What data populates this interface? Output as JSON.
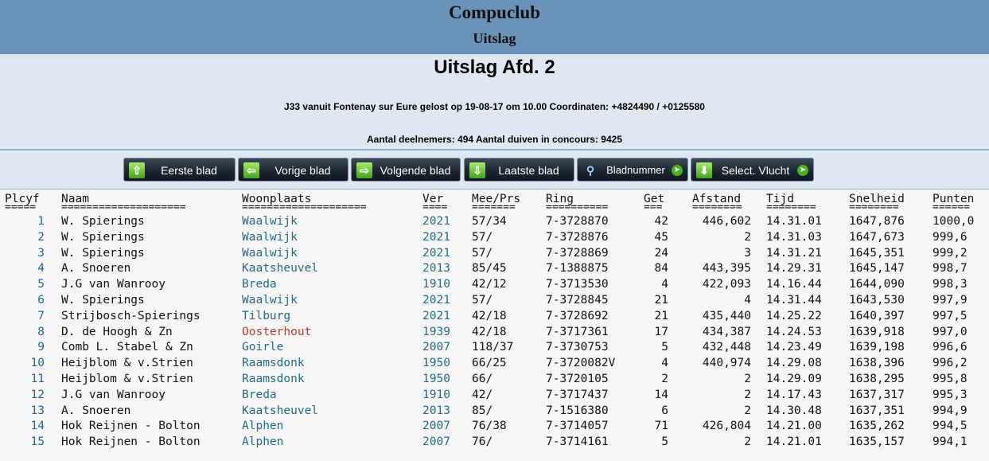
{
  "header": {
    "club": "Compuclub",
    "subtitle": "Uitslag"
  },
  "info": {
    "title": "Uitslag Afd. 2",
    "flight": "J33 vanuit Fontenay sur Eure gelost op 19-08-17 om 10.00 Coordinaten: +4824490 / +0125580",
    "participants": "Aantal deelnemers: 494 Aantal duiven in concours: 9425"
  },
  "nav": {
    "first": "Eerste blad",
    "prev": "Vorige blad",
    "next": "Volgende blad",
    "last": "Laatste blad",
    "page": "Bladnummer",
    "select": "Select. Vlucht"
  },
  "table": {
    "headers": {
      "plcyf": "Plcyf",
      "naam": "Naam",
      "woonplaats": "Woonplaats",
      "ver": "Ver",
      "mee": "Mee/Prs",
      "ring": "Ring",
      "get": "Get",
      "afstand": "Afstand",
      "tijd": "Tijd",
      "snelheid": "Snelheid",
      "punten": "Punten"
    },
    "separators": {
      "plcyf": "=====",
      "naam": "====================",
      "woonplaats": "====================",
      "ver": "====",
      "mee": "=======",
      "ring": "==========",
      "get": "===",
      "afstand": "========",
      "tijd": "========",
      "snelheid": "========",
      "punten": "======"
    },
    "rows": [
      {
        "plcyf": "1",
        "naam": "W. Spierings",
        "woonplaats": "Waalwijk",
        "ver": "2021",
        "mee": "57/34",
        "ring": "7-3728870",
        "get": "42",
        "afstand": "446,602",
        "tijd": "14.31.01",
        "snelheid": "1647,876",
        "punten": "1000,0"
      },
      {
        "plcyf": "2",
        "naam": "W. Spierings",
        "woonplaats": "Waalwijk",
        "ver": "2021",
        "mee": "57/",
        "ring": "7-3728876",
        "get": "45",
        "afstand": "2",
        "tijd": "14.31.03",
        "snelheid": "1647,673",
        "punten": "999,6"
      },
      {
        "plcyf": "3",
        "naam": "W. Spierings",
        "woonplaats": "Waalwijk",
        "ver": "2021",
        "mee": "57/",
        "ring": "7-3728869",
        "get": "24",
        "afstand": "3",
        "tijd": "14.31.21",
        "snelheid": "1645,351",
        "punten": "999,2"
      },
      {
        "plcyf": "4",
        "naam": "A. Snoeren",
        "woonplaats": "Kaatsheuvel",
        "ver": "2013",
        "mee": "85/45",
        "ring": "7-1388875",
        "get": "84",
        "afstand": "443,395",
        "tijd": "14.29.31",
        "snelheid": "1645,147",
        "punten": "998,7"
      },
      {
        "plcyf": "5",
        "naam": "J.G van Wanrooy",
        "woonplaats": "Breda",
        "ver": "1910",
        "mee": "42/12",
        "ring": "7-3713530",
        "get": "4",
        "afstand": "422,093",
        "tijd": "14.16.44",
        "snelheid": "1644,090",
        "punten": "998,3"
      },
      {
        "plcyf": "6",
        "naam": "W. Spierings",
        "woonplaats": "Waalwijk",
        "ver": "2021",
        "mee": "57/",
        "ring": "7-3728845",
        "get": "21",
        "afstand": "4",
        "tijd": "14.31.44",
        "snelheid": "1643,530",
        "punten": "997,9"
      },
      {
        "plcyf": "7",
        "naam": "Strijbosch-Spierings",
        "woonplaats": "Tilburg",
        "ver": "2021",
        "mee": "42/18",
        "ring": "7-3728692",
        "get": "21",
        "afstand": "435,440",
        "tijd": "14.25.22",
        "snelheid": "1640,397",
        "punten": "997,5"
      },
      {
        "plcyf": "8",
        "naam": "D. de Hoogh & Zn",
        "woonplaats": "Oosterhout",
        "ver": "1939",
        "mee": "42/18",
        "ring": "7-3717361",
        "get": "17",
        "afstand": "434,387",
        "tijd": "14.24.53",
        "snelheid": "1639,918",
        "punten": "997,0",
        "red": true
      },
      {
        "plcyf": "9",
        "naam": "Comb L. Stabel & Zn",
        "woonplaats": "Goirle",
        "ver": "2007",
        "mee": "118/37",
        "ring": "7-3730753",
        "get": "5",
        "afstand": "432,448",
        "tijd": "14.23.49",
        "snelheid": "1639,198",
        "punten": "996,6"
      },
      {
        "plcyf": "10",
        "naam": "Heijblom & v.Strien",
        "woonplaats": "Raamsdonk",
        "ver": "1950",
        "mee": "66/25",
        "ring": "7-3720082V",
        "get": "4",
        "afstand": "440,974",
        "tijd": "14.29.08",
        "snelheid": "1638,396",
        "punten": "996,2"
      },
      {
        "plcyf": "11",
        "naam": "Heijblom & v.Strien",
        "woonplaats": "Raamsdonk",
        "ver": "1950",
        "mee": "66/",
        "ring": "7-3720105",
        "get": "2",
        "afstand": "2",
        "tijd": "14.29.09",
        "snelheid": "1638,295",
        "punten": "995,8"
      },
      {
        "plcyf": "12",
        "naam": "J.G van Wanrooy",
        "woonplaats": "Breda",
        "ver": "1910",
        "mee": "42/",
        "ring": "7-3717437",
        "get": "14",
        "afstand": "2",
        "tijd": "14.17.43",
        "snelheid": "1637,317",
        "punten": "995,3"
      },
      {
        "plcyf": "13",
        "naam": "A. Snoeren",
        "woonplaats": "Kaatsheuvel",
        "ver": "2013",
        "mee": "85/",
        "ring": "7-1516380",
        "get": "6",
        "afstand": "2",
        "tijd": "14.30.48",
        "snelheid": "1637,351",
        "punten": "994,9"
      },
      {
        "plcyf": "14",
        "naam": "Hok Reijnen - Bolton",
        "woonplaats": "Alphen",
        "ver": "2007",
        "mee": "76/38",
        "ring": "7-3714057",
        "get": "71",
        "afstand": "426,804",
        "tijd": "14.21.00",
        "snelheid": "1635,262",
        "punten": "994,5"
      },
      {
        "plcyf": "15",
        "naam": "Hok Reijnen - Bolton",
        "woonplaats": "Alphen",
        "ver": "2007",
        "mee": "76/",
        "ring": "7-3714161",
        "get": "5",
        "afstand": "2",
        "tijd": "14.21.01",
        "snelheid": "1635,157",
        "punten": "994,1"
      }
    ]
  },
  "colors": {
    "topbar": "#6a93b9",
    "infobox": "#dfe8f1",
    "link": "#1f6b8a",
    "link_red": "#c0392b",
    "button_icon": "#47b021"
  },
  "icons": {
    "first": "arrow-up-icon",
    "prev": "arrow-left-icon",
    "next": "arrow-right-icon",
    "last": "arrow-down-icon",
    "page": "magnifier-icon",
    "select": "download-icon"
  }
}
